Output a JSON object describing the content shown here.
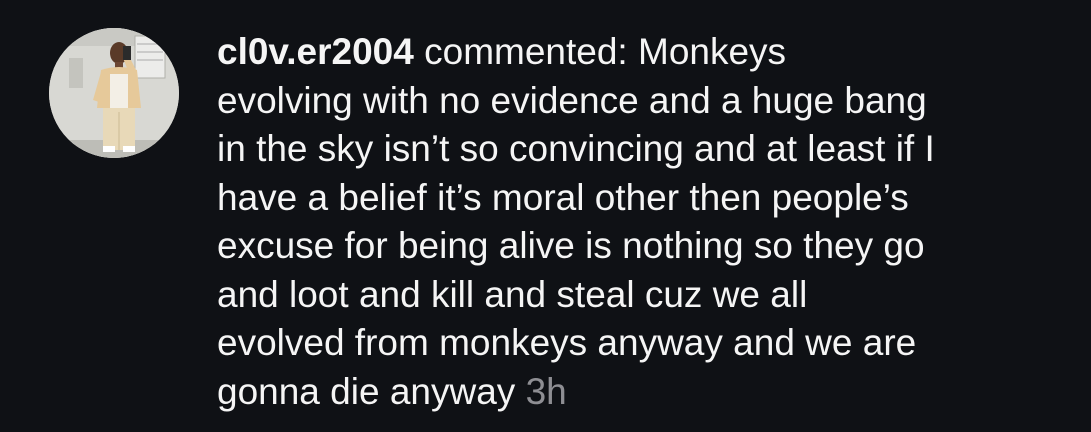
{
  "comment": {
    "username": "cl0v.er2004",
    "action": " commented: ",
    "text": "Monkeys\nevolving with no evidence and a huge bang\nin the sky isn’t so convincing and at least if I\nhave a belief it’s moral other then people’s\nexcuse for being alive is nothing so they go\nand loot and kill and steal cuz we all\nevolved from monkeys anyway and we are\ngonna die anyway",
    "timestamp": "3h"
  }
}
